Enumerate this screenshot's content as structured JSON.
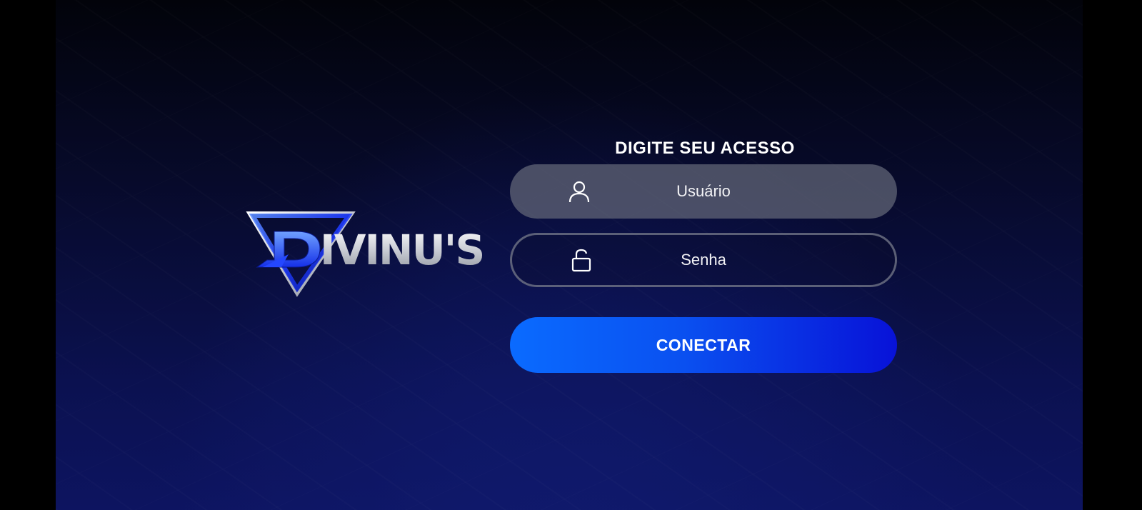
{
  "brand": {
    "logo_text": "DIVINU'S",
    "logo_wordmark": "IVINU'S"
  },
  "login": {
    "heading": "DIGITE SEU ACESSO",
    "username": {
      "placeholder": "Usuário",
      "icon": "user-icon"
    },
    "password": {
      "placeholder": "Senha",
      "icon": "unlock-icon"
    },
    "connect_label": "CONECTAR"
  },
  "colors": {
    "background_top": "#02030a",
    "background_bottom": "#0d1460",
    "button_start": "#0a6bff",
    "button_end": "#0812d8",
    "field_fill": "#64687a",
    "logo_blue": "#1a3cff"
  }
}
